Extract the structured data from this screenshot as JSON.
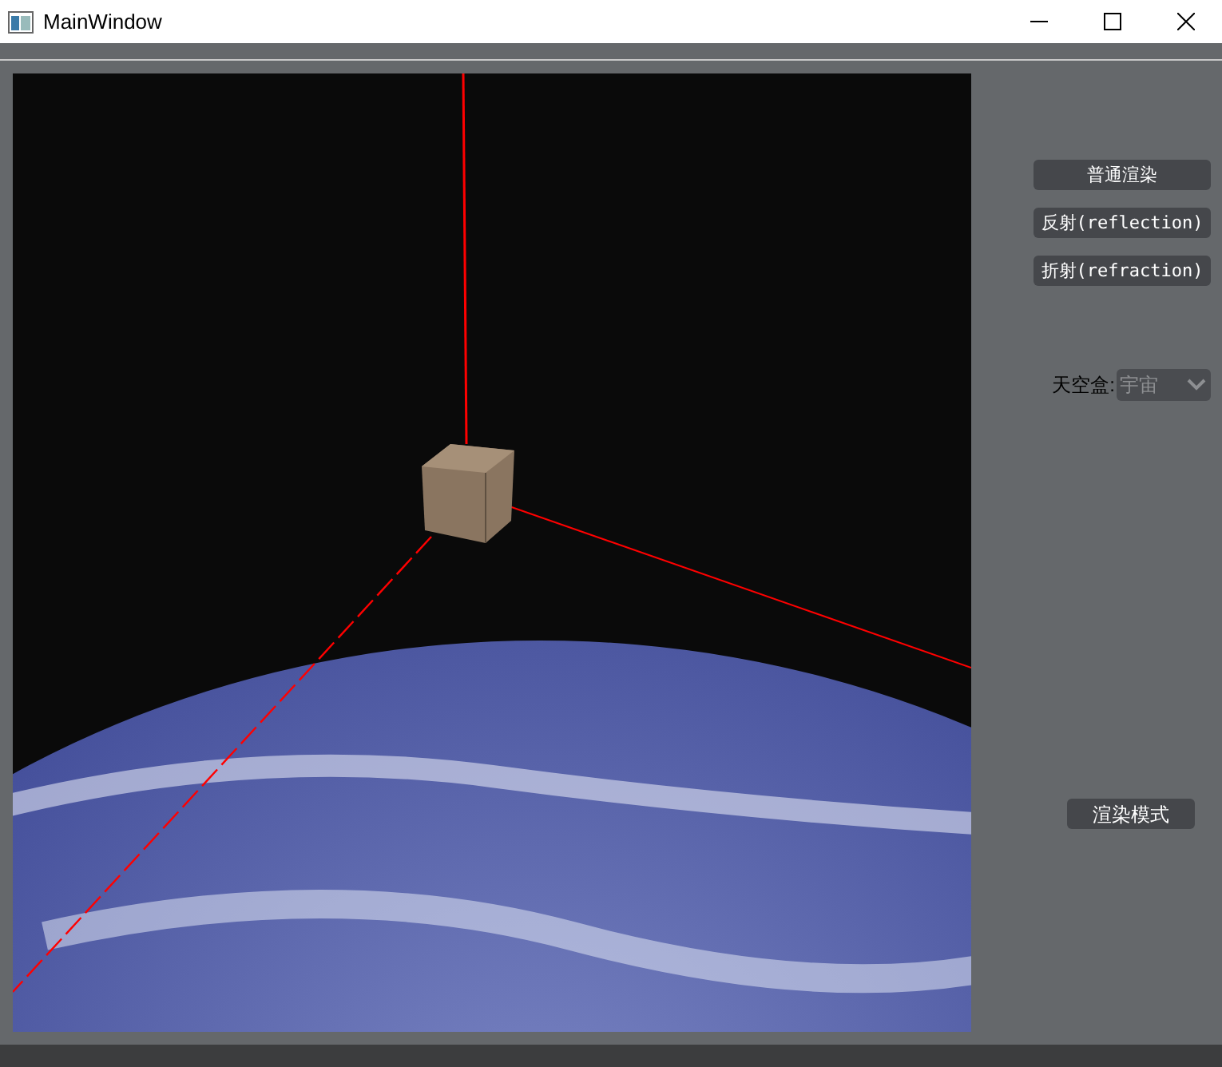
{
  "window": {
    "title": "MainWindow"
  },
  "render_buttons": [
    {
      "label": "普通渲染"
    },
    {
      "label": "反射(reflection)"
    },
    {
      "label": "折射(refraction)"
    }
  ],
  "skybox": {
    "label": "天空盒:",
    "value": "宇宙",
    "disabled": true
  },
  "mode_button": {
    "label": "渲染模式"
  }
}
